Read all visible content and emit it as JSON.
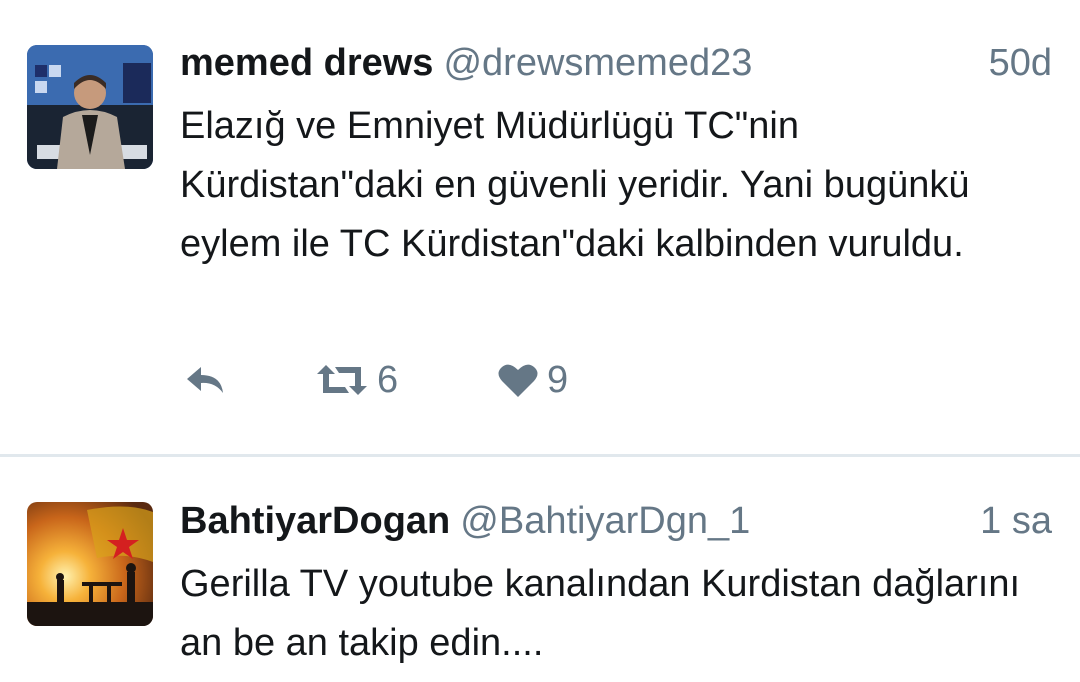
{
  "tweets": [
    {
      "name": "memed drews",
      "handle": "@drewsmemed23",
      "time": "50d",
      "text": "Elazığ ve Emniyet Müdürlügü TC\"nin Kürdistan\"daki en güvenli yeridir. Yani bugünkü eylem ile TC Kürdistan\"daki kalbinden vuruldu.",
      "retweets": "6",
      "likes": "9"
    },
    {
      "name": "BahtiyarDogan",
      "handle": "@BahtiyarDgn_1",
      "time": "1 sa",
      "text": "Gerilla TV youtube kanalından Kurdistan dağlarını an be an takip edin...."
    }
  ],
  "icons": {
    "reply": "reply-icon",
    "retweet": "retweet-icon",
    "like": "heart-icon"
  },
  "colors": {
    "secondary_text": "#657786",
    "icon": "#657786",
    "divider": "#e1e8ed"
  }
}
